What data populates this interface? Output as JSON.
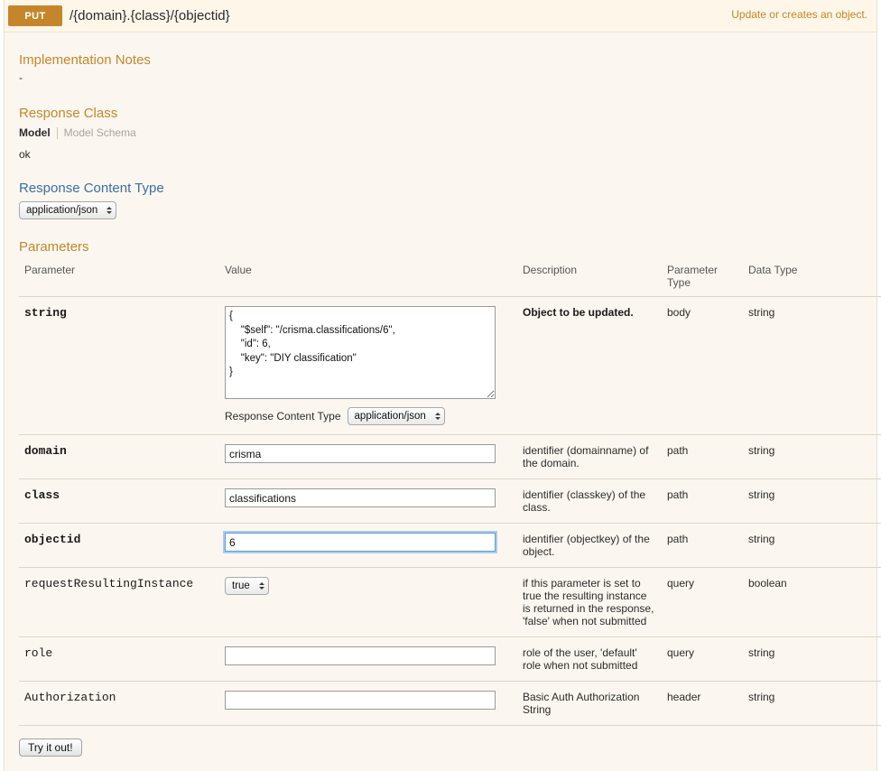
{
  "operation": {
    "method": "PUT",
    "path": "/{domain}.{class}/{objectid}",
    "summary": "Update or creates an object."
  },
  "sections": {
    "implementation_notes_title": "Implementation Notes",
    "implementation_notes_text": "-",
    "response_class_title": "Response Class",
    "model_tab": "Model",
    "model_schema_tab": "Model Schema",
    "model_body": "ok",
    "response_content_type_title": "Response Content Type",
    "response_content_type_value": "application/json",
    "parameters_title": "Parameters"
  },
  "table_headers": {
    "parameter": "Parameter",
    "value": "Value",
    "description": "Description",
    "parameter_type": "Parameter Type",
    "data_type": "Data Type"
  },
  "rows": [
    {
      "name": "string",
      "required": true,
      "control": "textarea",
      "value": "{\n    \"$self\": \"/crisma.classifications/6\",\n    \"id\": 6,\n    \"key\": \"DIY classification\"\n}",
      "value_json_prefix": "{\n    \"$self\": \"/",
      "value_json_squiggle": "crisma.classifications",
      "value_json_suffix": "/6\",\n    \"id\": 6,\n    \"key\": \"DIY classification\"\n}",
      "sub_label": "Response Content Type",
      "sub_value": "application/json",
      "description": "Object to be updated.",
      "description_bold": true,
      "parameter_type": "body",
      "data_type": "string"
    },
    {
      "name": "domain",
      "required": true,
      "control": "input",
      "value": "crisma",
      "focused": false,
      "description": "identifier (domainname) of the domain.",
      "description_bold": false,
      "parameter_type": "path",
      "data_type": "string"
    },
    {
      "name": "class",
      "required": true,
      "control": "input",
      "value": "classifications",
      "focused": false,
      "description": "identifier (classkey) of the class.",
      "description_bold": false,
      "parameter_type": "path",
      "data_type": "string"
    },
    {
      "name": "objectid",
      "required": true,
      "control": "input",
      "value": "6",
      "focused": true,
      "description": "identifier (objectkey) of the object.",
      "description_bold": false,
      "parameter_type": "path",
      "data_type": "string"
    },
    {
      "name": "requestResultingInstance",
      "required": false,
      "control": "select",
      "value": "true",
      "description": "if this parameter is set to true the resulting instance is returned in the response, 'false' when not submitted",
      "description_bold": false,
      "parameter_type": "query",
      "data_type": "boolean"
    },
    {
      "name": "role",
      "required": false,
      "control": "input",
      "value": "",
      "focused": false,
      "description": "role of the user, 'default' role when not submitted",
      "description_bold": false,
      "parameter_type": "query",
      "data_type": "string"
    },
    {
      "name": "Authorization",
      "required": false,
      "control": "input",
      "value": "",
      "focused": false,
      "description": "Basic Auth Authorization String",
      "description_bold": false,
      "parameter_type": "header",
      "data_type": "string"
    }
  ],
  "submit": {
    "label": "Try it out!"
  },
  "colors": {
    "accent_orange": "#c5862b",
    "accent_blue": "#3b6ea5",
    "panel_background": "#fbf7f0",
    "heading_background": "#fdf6e9",
    "border": "#ded6c6"
  }
}
